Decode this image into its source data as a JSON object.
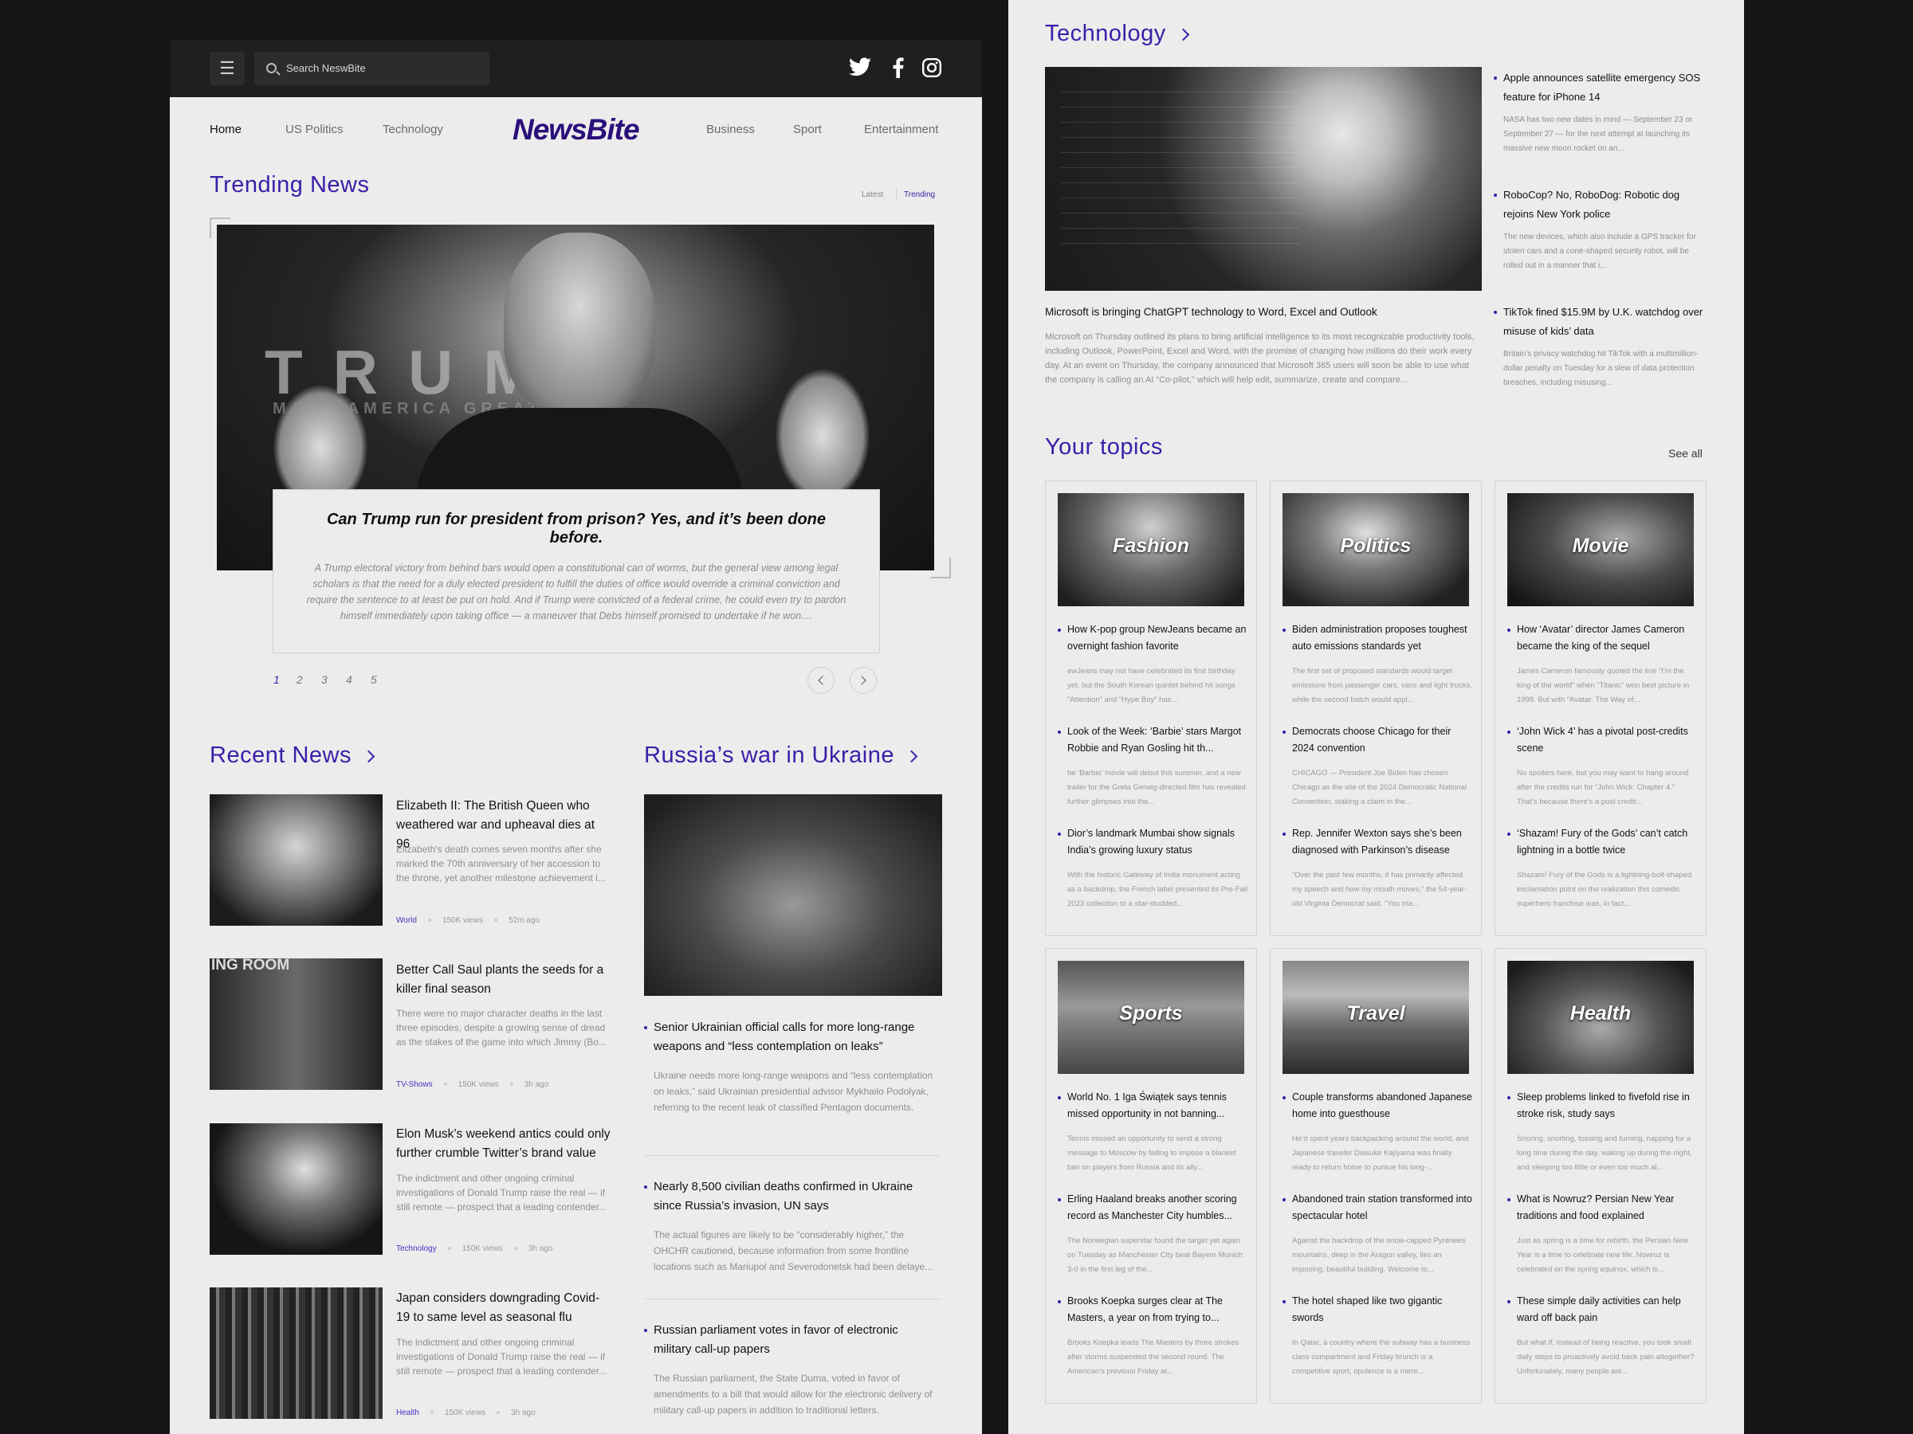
{
  "header": {
    "search_placeholder": "Search NeswBite",
    "logo": "NewsBite"
  },
  "nav": {
    "left": [
      "Home",
      "US Politics",
      "Technology"
    ],
    "right": [
      "Business",
      "Sport",
      "Entertainment"
    ]
  },
  "trending": {
    "title": "Trending News",
    "filters": [
      "Latest",
      "Trending"
    ],
    "headline": "Can Trump run for president from prison? Yes, and it’s been done before.",
    "summary": "A Trump electoral victory from behind bars would open a constitutional can of worms, but the general view among legal scholars is that the need for a duly elected president to fulfill the duties of office would override a criminal conviction and require the sentence to at least be put on hold. And if Trump were convicted of a federal crime, he could even try to pardon himself immediately upon taking office — a maneuver that Debs himself promised to undertake if he won....",
    "pages": [
      "1",
      "2",
      "3",
      "4",
      "5"
    ],
    "photo_text": "TRUMP",
    "photo_subtext": "MAKE AMERICA GREAT AGAIN"
  },
  "recent": {
    "title": "Recent News",
    "items": [
      {
        "title": "Elizabeth II: The British Queen who weathered war and upheaval dies at 96",
        "desc": "Elizabeth's death comes seven months after she marked the 70th anniversary of her accession to the throne, yet another milestone achievement i...",
        "cat": "World",
        "views": "150K views",
        "time": "52m ago"
      },
      {
        "title": "Better Call Saul plants the seeds for a killer final season",
        "desc": "There were no major character deaths in the last three episodes, despite a growing sense of dread as the stakes of the game into which Jimmy (Bo...",
        "cat": "TV-Shows",
        "views": "150K views",
        "time": "3h ago",
        "photo_text": "ING ROOM"
      },
      {
        "title": "Elon Musk’s weekend antics could only further crumble Twitter’s brand value",
        "desc": "The indictment and other ongoing criminal investigations of Donald Trump raise the real — if still remote — prospect that a leading contender...",
        "cat": "Technology",
        "views": "150K views",
        "time": "3h ago"
      },
      {
        "title": "Japan considers downgrading Covid-19 to same level as seasonal flu",
        "desc": "The indictment and other ongoing criminal investigations of Donald Trump raise the real — if still remote — prospect that a leading contender...",
        "cat": "Health",
        "views": "150K views",
        "time": "3h ago"
      }
    ]
  },
  "ukraine": {
    "title": "Russia’s war in Ukraine",
    "items": [
      {
        "title": "Senior Ukrainian official calls for more long-range weapons and “less contemplation on leaks”",
        "desc": "Ukraine needs more long-range weapons and “less contemplation on leaks,” said Ukrainian presidential advisor Mykhailo Podolyak, referring to the recent leak of classified Pentagon documents."
      },
      {
        "title": "Nearly 8,500 civilian deaths confirmed in Ukraine since Russia’s invasion, UN says",
        "desc": "The actual figures are likely to be “considerably higher,” the OHCHR cautioned, because information from some frontline locations such as Mariupol and Severodonetsk had been delaye..."
      },
      {
        "title": "Russian parliament votes in favor of electronic military call-up papers",
        "desc": "The Russian parliament, the State Duma, voted in favor of amendments to a bill that would allow for the electronic delivery of military call-up papers in addition to traditional letters."
      }
    ]
  },
  "tech": {
    "title": "Technology",
    "main_title": "Microsoft is bringing ChatGPT technology to Word, Excel and Outlook",
    "main_desc": "Microsoft on Thursday outlined its plans to bring artificial intelligence to its most recognizable productivity tools, including Outlook, PowerPoint, Excel and Word, with the promise of changing how millions do their work every day. At an event on Thursday, the company announced that Microsoft 365 users will soon be able to use what the company is calling an AI “Co-pilot,” which will help edit, summarize, create and compare...",
    "side": [
      {
        "title": "Apple announces satellite emergency SOS feature for iPhone 14",
        "desc": "NASA has two new dates in mind — September 23 or September 27 — for the next attempt at launching its massive new moon rocket on an..."
      },
      {
        "title": "RoboCop? No, RoboDog: Robotic dog rejoins New York police",
        "desc": "The new devices, which also include a GPS tracker for stolen cars and a cone-shaped security robot, will be rolled out in a manner that i..."
      },
      {
        "title": "TikTok fined $15.9M by U.K. watchdog over misuse of kids’ data",
        "desc": "Britain’s privacy watchdog hit TikTok with a multimillion-dollar penalty on Tuesday for a slew of data protection breaches, including misusing..."
      }
    ]
  },
  "topics": {
    "title": "Your topics",
    "see_all": "See all",
    "cards": [
      {
        "label": "Fashion",
        "items": [
          {
            "title": "How K-pop group NewJeans became an overnight fashion favorite",
            "desc": "ewJeans may not have celebrated its first birthday yet, but the South Korean quintet behind hit songs “Attention” and “Hype Boy” has..."
          },
          {
            "title": "Look of the Week: ‘Barbie’ stars Margot Robbie and Ryan Gosling hit th...",
            "desc": "he ‘Barbie’ movie will debut this summer, and a new trailer for the Greta Gerwig-directed film has revealed further glimpses into the..."
          },
          {
            "title": "Dior’s landmark Mumbai show signals India’s growing luxury status",
            "desc": "With the historic Gateway of India monument acting as a backdrop, the French label presented its Pre-Fall 2023 collection to a star-studded..."
          }
        ]
      },
      {
        "label": "Politics",
        "items": [
          {
            "title": "Biden administration proposes toughest auto emissions standards yet",
            "desc": "The first set of proposed standards would target emissions from passenger cars, vans and light trucks, while the second batch would appl..."
          },
          {
            "title": "Democrats choose Chicago for their 2024 convention",
            "desc": "CHICAGO — President Joe Biden has chosen Chicago as the site of the 2024 Democratic National Convention, staking a claim in the..."
          },
          {
            "title": "Rep. Jennifer Wexton says she’s been diagnosed with Parkinson’s disease",
            "desc": "“Over the past few months, it has primarily affected my speech and how my mouth moves,” the 54-year-old Virginia Democrat said. “You ma..."
          }
        ]
      },
      {
        "label": "Movie",
        "items": [
          {
            "title": "How ‘Avatar’ director James Cameron became the king of the sequel",
            "desc": "James Cameron famously quoted the line “I’m the king of the world” when “Titanic” won best picture in 1998. But with “Avatar: The Way of..."
          },
          {
            "title": "‘John Wick 4’ has a pivotal post-credits scene",
            "desc": "No spoilers here, but you may want to hang around after the credits run for “John Wick: Chapter 4.” That’s because there’s a post credit..."
          },
          {
            "title": "‘Shazam! Fury of the Gods’ can’t catch lightning in a bottle twice",
            "desc": "Shazam! Fury of the Gods is a lightning-bolt-shaped exclamation point on the realization this comedic superhero franchise was, in fact..."
          }
        ]
      },
      {
        "label": "Sports",
        "items": [
          {
            "title": "World No. 1 Iga Świątek says tennis missed opportunity in not banning...",
            "desc": "Tennis missed an opportunity to send a strong message to Moscow by failing to impose a blanket ban on players from Russia and its ally..."
          },
          {
            "title": "Erling Haaland breaks another scoring record as Manchester City humbles...",
            "desc": "The Norwegian superstar found the target yet again on Tuesday as Manchester City beat Bayern Munich 3-0 in the first leg of the..."
          },
          {
            "title": "Brooks Koepka surges clear at The Masters, a year on from trying to...",
            "desc": "Brooks Koepka leads The Masters by three strokes after storms suspended the second round. The American’s previous Friday at..."
          }
        ]
      },
      {
        "label": "Travel",
        "items": [
          {
            "title": "Couple transforms abandoned Japanese home into guesthouse",
            "desc": "He’d spent years backpacking around the world, and Japanese traveler Daisuke Kajiyama was finally ready to return home to pursue his long-..."
          },
          {
            "title": "Abandoned train station transformed into spectacular hotel",
            "desc": "Against the backdrop of the snow-capped Pyrenees mountains, deep in the Aragon valley, lies an imposing, beautiful building. Welcome to..."
          },
          {
            "title": "The hotel shaped like two gigantic swords",
            "desc": "In Qatar, a country where the subway has a business class compartment and Friday brunch is a competitive sport, opulence is a mere..."
          }
        ]
      },
      {
        "label": "Health",
        "items": [
          {
            "title": "Sleep problems linked to fivefold rise in stroke risk, study says",
            "desc": "Snoring, snorting, tossing and turning, napping for a long time during the day, waking up during the night, and sleeping too little or even too much al..."
          },
          {
            "title": "What is Nowruz? Persian New Year traditions and food explained",
            "desc": "Just as spring is a time for rebirth, the Persian New Year is a time to celebrate new life. Nowruz is celebrated on the spring equinox, which is..."
          },
          {
            "title": "These simple daily activities can help ward off back pain",
            "desc": "But what if, instead of being reactive, you took small daily steps to proactively avoid back pain altogether? Unfortunately, many people are..."
          }
        ]
      }
    ]
  }
}
